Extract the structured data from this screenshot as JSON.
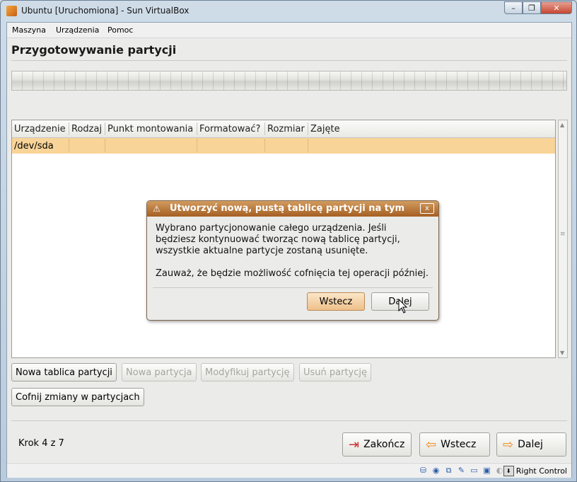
{
  "window": {
    "title": "Ubuntu [Uruchomiona] - Sun VirtualBox",
    "controls": {
      "minimize": "–",
      "restore": "❐",
      "close": "✕"
    }
  },
  "menubar": [
    "Maszyna",
    "Urządzenia",
    "Pomoc"
  ],
  "installer": {
    "page_title": "Przygotowywanie partycji",
    "table": {
      "columns": [
        "Urządzenie",
        "Rodzaj",
        "Punkt montowania",
        "Formatować?",
        "Rozmiar",
        "Zajęte"
      ],
      "rows": [
        {
          "device": "/dev/sda",
          "type": "",
          "mount": "",
          "format": "",
          "size": "",
          "used": ""
        }
      ]
    },
    "buttons": {
      "new_table": "Nowa tablica partycji",
      "new_partition": "Nowa partycja",
      "modify": "Modyfikuj partycję",
      "delete": "Usuń partycję",
      "revert": "Cofnij zmiany w partycjach"
    },
    "step": "Krok 4 z 7",
    "nav": {
      "quit": "Zakończ",
      "back": "Wstecz",
      "next": "Dalej"
    }
  },
  "dialog": {
    "title": "Utworzyć nową, pustą tablicę partycji na tym",
    "close": "x",
    "paragraph1_line1": "Wybrano partycjonowanie całego urządzenia. Jeśli",
    "paragraph1_line2": "będziesz kontynuować tworząc nową tablicę partycji,",
    "paragraph1_line3": "wszystkie aktualne partycje zostaną usunięte.",
    "paragraph2": "Zauważ, że będzie możliwość cofnięcia tej operacji później.",
    "btn_back": "Wstecz",
    "btn_next": "Dalej"
  },
  "statusbar": {
    "host_key": "Right Control"
  }
}
